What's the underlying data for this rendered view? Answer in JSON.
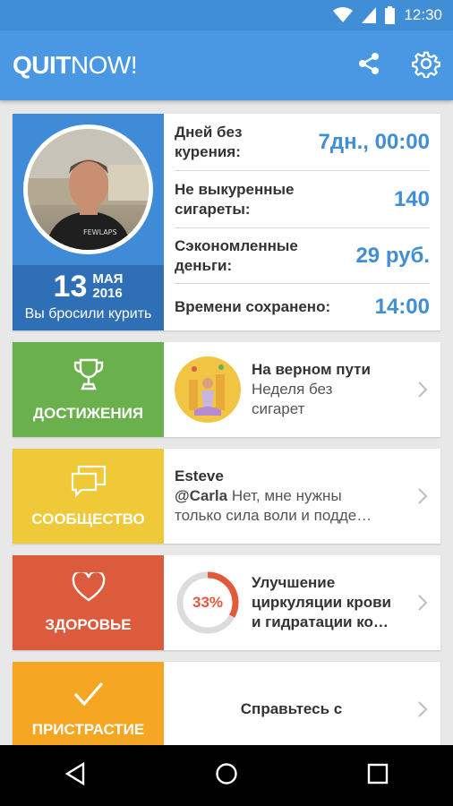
{
  "status_bar": {
    "time": "12:30"
  },
  "app_bar": {
    "logo_bold": "QUIT",
    "logo_light": "NOW!"
  },
  "profile": {
    "date_day": "13",
    "date_month": "МАЯ",
    "date_year": "2016",
    "caption": "Вы бросили курить",
    "stats": [
      {
        "label_l1": "Дней без",
        "label_l2": "курения:",
        "value": "7дн., 00:00"
      },
      {
        "label_l1": "Не выкуренные",
        "label_l2": "сигареты:",
        "value": "140"
      },
      {
        "label_l1": "Сэкономленные",
        "label_l2": "деньги:",
        "value": "29 руб."
      },
      {
        "label_l1": "Времени сохранено:",
        "label_l2": "",
        "value": "14:00"
      }
    ]
  },
  "rows": {
    "achievements": {
      "tile_label": "ДОСТИЖЕНИЯ",
      "title": "На верном пути",
      "sub_l1": "Неделя без",
      "sub_l2": "сигарет",
      "color": "#6ab04c"
    },
    "community": {
      "tile_label": "СООБЩЕСТВО",
      "title": "Esteve",
      "mention": "@Carla",
      "sub_l1": " Нет, мне нужны",
      "sub_l2": "только сила воли и подде…",
      "color": "#efc938"
    },
    "health": {
      "tile_label": "ЗДОРОВЬЕ",
      "progress_percent": 33,
      "progress_label": "33%",
      "title_l1": "Улучшение",
      "title_l2": "циркуляции крови",
      "title_l3": "и гидратации ко…",
      "color": "#db5b3c"
    },
    "addiction": {
      "tile_label": "ПРИСТРАСТИЕ",
      "text": "Справьтесь с",
      "color": "#f5a623"
    }
  }
}
